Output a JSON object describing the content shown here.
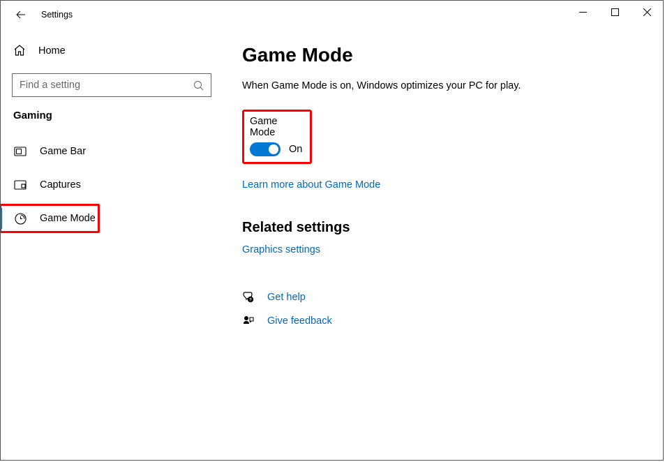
{
  "titlebar": {
    "title": "Settings"
  },
  "sidebar": {
    "home_label": "Home",
    "search_placeholder": "Find a setting",
    "category": "Gaming",
    "items": [
      {
        "label": "Game Bar"
      },
      {
        "label": "Captures"
      },
      {
        "label": "Game Mode"
      }
    ]
  },
  "main": {
    "title": "Game Mode",
    "description": "When Game Mode is on, Windows optimizes your PC for play.",
    "toggle_label": "Game Mode",
    "toggle_state": "On",
    "learn_more_link": "Learn more about Game Mode",
    "related_header": "Related settings",
    "graphics_link": "Graphics settings",
    "get_help_label": "Get help",
    "give_feedback_label": "Give feedback"
  }
}
